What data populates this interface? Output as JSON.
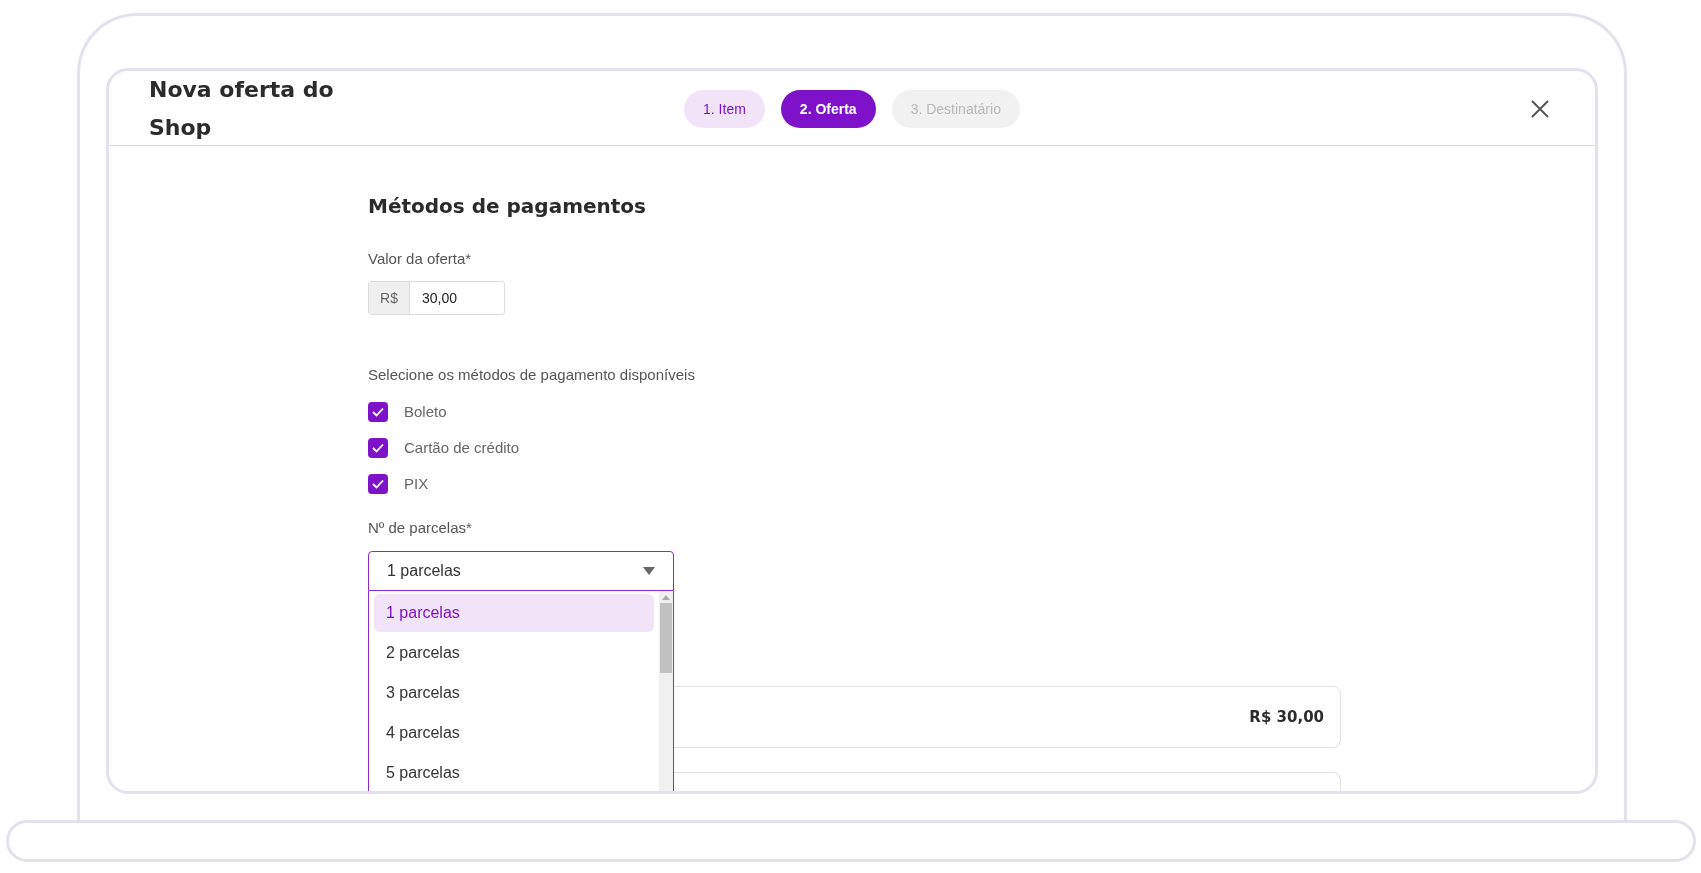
{
  "dialog": {
    "title": "Nova oferta do Shop",
    "steps": [
      {
        "label": "1. Item",
        "selected": false,
        "disabled": false
      },
      {
        "label": "2. Oferta",
        "selected": true,
        "disabled": false
      },
      {
        "label": "3. Destinatário",
        "selected": false,
        "disabled": true
      }
    ]
  },
  "section_title": "Métodos de pagamentos",
  "offer_value": {
    "label": "Valor da oferta*",
    "currency": "R$",
    "value": "30,00"
  },
  "methods_label": "Selecione os métodos de pagamento disponíveis",
  "methods": [
    {
      "label": "Boleto",
      "checked": true
    },
    {
      "label": "Cartão de crédito",
      "checked": true
    },
    {
      "label": "PIX",
      "checked": true
    }
  ],
  "installments": {
    "label": "Nº de parcelas*",
    "value": "1 parcelas",
    "expanded": true,
    "options": [
      {
        "label": "1 parcelas",
        "selected": true
      },
      {
        "label": "2 parcelas",
        "selected": false
      },
      {
        "label": "3 parcelas",
        "selected": false
      },
      {
        "label": "4 parcelas",
        "selected": false
      },
      {
        "label": "5 parcelas",
        "selected": false
      }
    ]
  },
  "summary_cards": [
    {
      "kind": "total",
      "amount": "R$ 30,00"
    },
    {
      "kind": "blank"
    }
  ]
}
